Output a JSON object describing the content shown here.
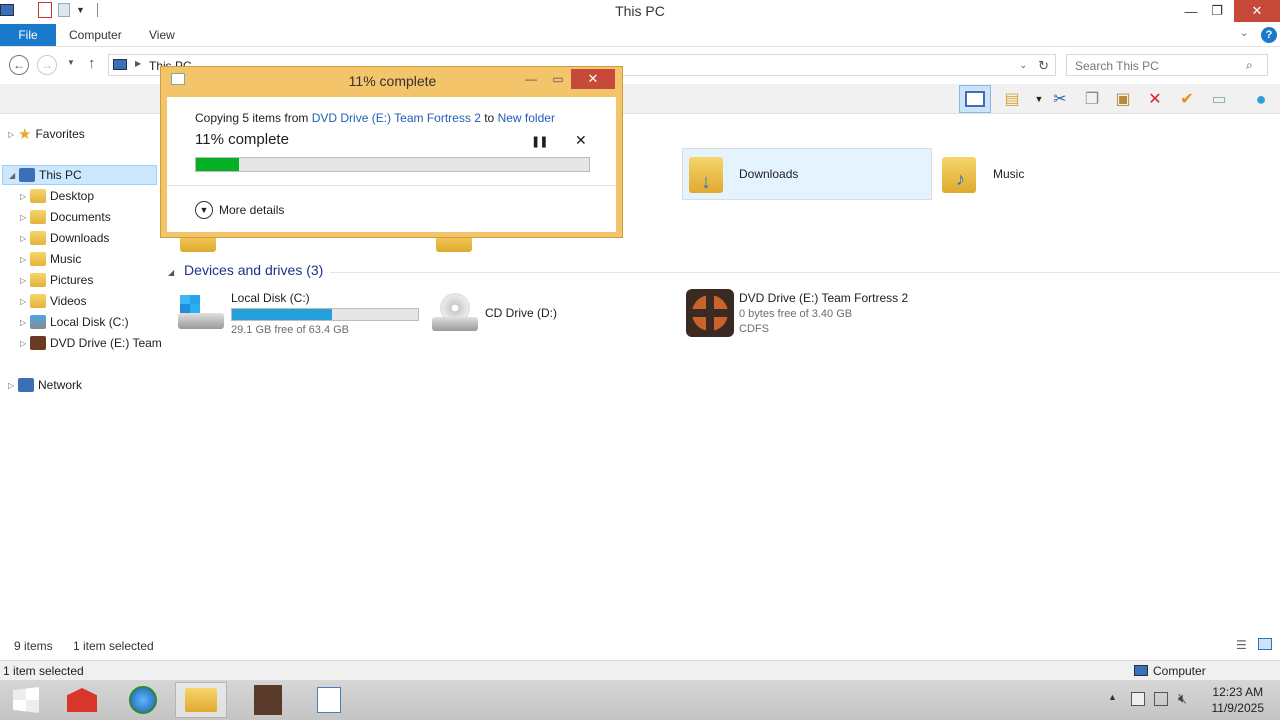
{
  "window": {
    "title": "This PC"
  },
  "ribbon": {
    "tabs": [
      "File",
      "Computer",
      "View"
    ]
  },
  "address": {
    "path": "This PC",
    "search_placeholder": "Search This PC"
  },
  "sidebar": {
    "favorites": "Favorites",
    "this_pc": "This PC",
    "items": [
      "Desktop",
      "Documents",
      "Downloads",
      "Music",
      "Pictures",
      "Videos",
      "Local Disk (C:)",
      "DVD Drive (E:) Team"
    ],
    "network": "Network"
  },
  "folders": {
    "downloads": "Downloads",
    "music": "Music"
  },
  "devices": {
    "header": "Devices and drives (3)",
    "local_disk": {
      "label": "Local Disk (C:)",
      "free": "29.1 GB free of 63.4 GB",
      "used_fraction": 0.54
    },
    "cd_drive": {
      "label": "CD Drive (D:)"
    },
    "dvd_drive": {
      "label": "DVD Drive (E:) Team Fortress 2",
      "free": "0 bytes free of 3.40 GB",
      "fs": "CDFS"
    }
  },
  "dialog": {
    "title": "11% complete",
    "copy_prefix": "Copying 5 items from",
    "source": "DVD Drive (E:) Team Fortress 2",
    "to": "to",
    "dest": "New folder",
    "progress_text": "11% complete",
    "progress_fraction": 0.11,
    "more_details": "More details"
  },
  "status": {
    "items": "9 items",
    "selected": "1 item selected",
    "bottom_left": "1 item selected",
    "bottom_right": "Computer"
  },
  "clock": {
    "time": "12:23 AM",
    "date": "11/9/2025"
  },
  "colors": {
    "accent": "#1979ca",
    "progress": "#06b025",
    "disk_bar": "#26a0da",
    "dialog_frame": "#f4c46a"
  }
}
